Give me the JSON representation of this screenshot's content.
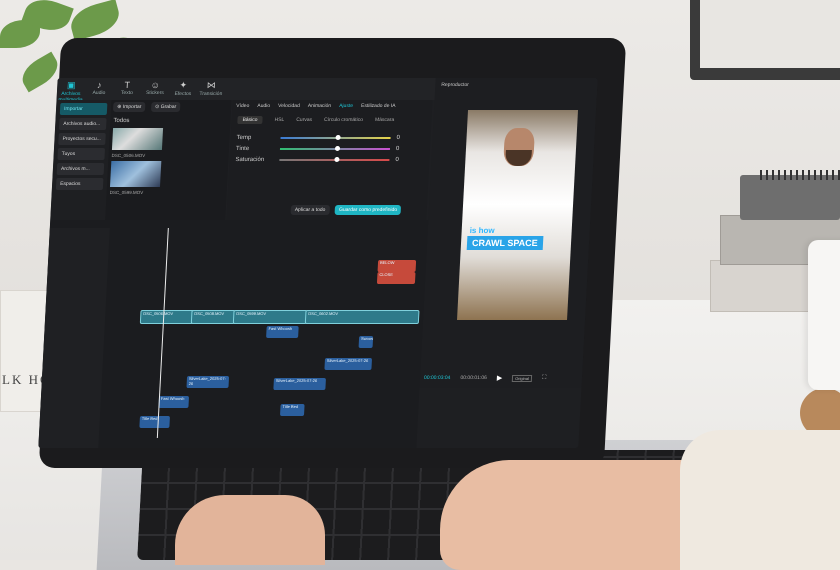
{
  "scene": {
    "book_spine_text": "LK HOME"
  },
  "editor": {
    "toolbar": [
      {
        "label": "Archivos multimedia",
        "icon": "media-icon",
        "active": true
      },
      {
        "label": "Audio",
        "icon": "audio-icon"
      },
      {
        "label": "Texto",
        "icon": "text-icon"
      },
      {
        "label": "Stickers",
        "icon": "sticker-icon"
      },
      {
        "label": "Efectos",
        "icon": "effects-icon"
      },
      {
        "label": "Transición",
        "icon": "transition-icon"
      }
    ],
    "left_nav": [
      "Importar",
      "Archivos audio...",
      "Proyectos secu...",
      "Tuyos",
      "Archivos m...",
      "Espacios"
    ],
    "media": {
      "import_label": "Importar",
      "record_label": "Grabar",
      "all_label": "Todos",
      "files": [
        "DSC_0506.MOV",
        "DSC_0599.MOV"
      ]
    },
    "props_tabs": [
      "Vídeo",
      "Audio",
      "Velocidad",
      "Animación",
      "Ajuste",
      "Estilizado de IA"
    ],
    "active_props_tab": "Ajuste",
    "props_subtabs": [
      "Básico",
      "HSL",
      "Curvas",
      "Círculo cromático",
      "Máscara"
    ],
    "sliders": [
      {
        "label": "Temp",
        "value": "0"
      },
      {
        "label": "Tinte",
        "value": "0"
      },
      {
        "label": "Saturación",
        "value": "0"
      }
    ],
    "apply_all": "Aplicar a todo",
    "save_preset": "Guardar como predefinido",
    "player": {
      "title": "Reproductor",
      "caption_line1": "is how",
      "caption_line2": "CRAWL SPACE",
      "timecode_current": "00:00:03:04",
      "timecode_total": "00:00:01:06",
      "ratio": "Original"
    },
    "timeline": {
      "clips": [
        {
          "label": "DSC_0506.MOV",
          "type": "video"
        },
        {
          "label": "DSC_0508.MOV",
          "type": "video"
        },
        {
          "label": "DSC_0599.MOV",
          "type": "video"
        },
        {
          "label": "DSC_0602.MOV",
          "type": "video"
        },
        {
          "label": "Fast Whoosh",
          "type": "audio"
        },
        {
          "label": "Swoosh",
          "type": "audio"
        },
        {
          "label": "SilverLake_2025-07-26",
          "type": "audio"
        },
        {
          "label": "SilverLake_2025-07-26",
          "type": "audio"
        },
        {
          "label": "SilverLake_2025-07-26",
          "type": "audio"
        },
        {
          "label": "Fast Whoosh",
          "type": "audio"
        },
        {
          "label": "Title Bed",
          "type": "audio"
        },
        {
          "label": "Title Bed",
          "type": "audio"
        },
        {
          "label": "BELOW",
          "type": "red"
        },
        {
          "label": "CLOSE",
          "type": "red"
        }
      ]
    }
  }
}
